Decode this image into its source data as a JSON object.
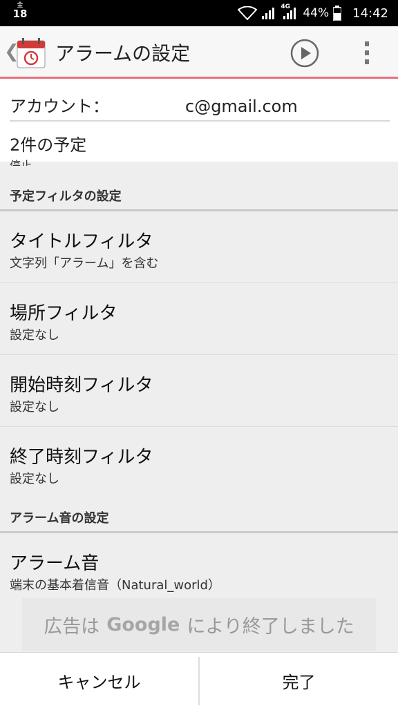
{
  "status_bar": {
    "weekday": "金",
    "day": "18",
    "network": "4G",
    "battery": "44%",
    "time": "14:42"
  },
  "action_bar": {
    "title": "アラームの設定",
    "icons": [
      "back-icon",
      "alarm-calendar-icon",
      "play-icon",
      "more-icon"
    ]
  },
  "header_info": {
    "account_prefix": "アカウント：",
    "account_suffix": "c@gmail.com",
    "events": "2件の予定",
    "partial_text": "停止"
  },
  "sections": {
    "filter_header": "予定フィルタの設定",
    "sound_header": "アラーム音の設定"
  },
  "items": [
    {
      "title": "タイトルフィルタ",
      "subtitle": "文字列「アラーム」を含む"
    },
    {
      "title": "場所フィルタ",
      "subtitle": "設定なし"
    },
    {
      "title": "開始時刻フィルタ",
      "subtitle": "設定なし"
    },
    {
      "title": "終了時刻フィルタ",
      "subtitle": "設定なし"
    },
    {
      "title": "アラーム音",
      "subtitle": "端末の基本着信音（Natural_world）"
    }
  ],
  "ad": {
    "prefix": "広告は",
    "brand": "Google",
    "suffix": "により終了しました"
  },
  "buttons": {
    "cancel": "キャンセル",
    "done": "完了"
  },
  "colors": {
    "accent_line": "#e9707f",
    "status_bar": "#000000",
    "background": "#eeeeee"
  }
}
